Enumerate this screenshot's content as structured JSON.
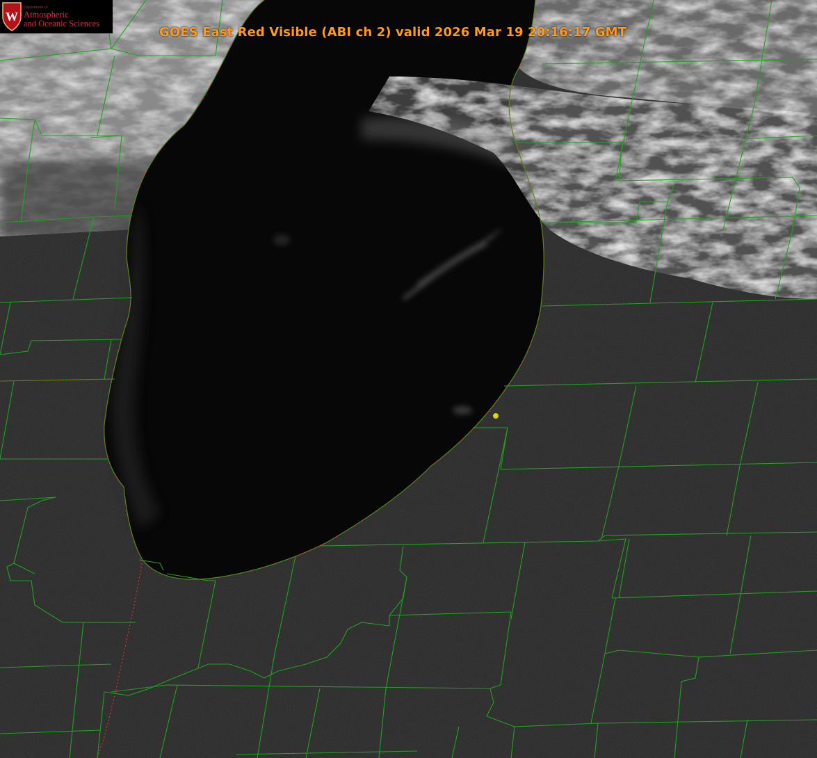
{
  "title": "GOES East Red Visible (ABI ch 2) valid 2026 Mar 19 20:16:17 GMT",
  "logo": {
    "department_line": "Department of",
    "name_line1": "Atmospheric",
    "name_line2": "and Oceanic Sciences",
    "crest_letter": "W"
  },
  "colors": {
    "title": "#ff9a1e",
    "county_borders": "#1fa31f",
    "state_border": "#d93b2b",
    "shoreline": "#c42a2a",
    "marker": "#d7d218",
    "lake": "#060606",
    "land": "#262626",
    "clouds": "#bdbdbd",
    "logo_red": "#d11f2f"
  },
  "map": {
    "product": "visible satellite imagery",
    "features": [
      "lake",
      "cloud-band",
      "county-borders",
      "state-border",
      "shoreline",
      "station-marker"
    ]
  }
}
